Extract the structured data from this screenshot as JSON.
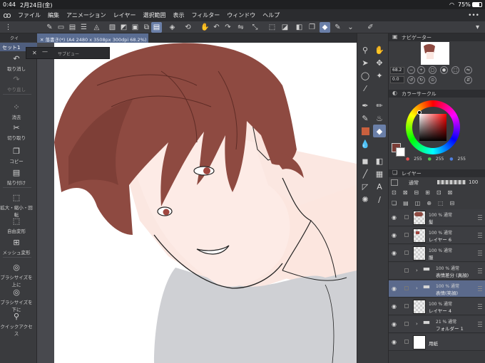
{
  "status": {
    "time": "0:44",
    "date": "2月24日(金)",
    "battery": "75%"
  },
  "menu": {
    "items": [
      "ファイル",
      "編集",
      "アニメーション",
      "レイヤー",
      "選択範囲",
      "表示",
      "フィルター",
      "ウィンドウ",
      "ヘルプ"
    ]
  },
  "tabs": {
    "left_panel_tab": "クイ",
    "document": "落書き(*) (A4 2480 x 3508px 300dpi 68.2%)"
  },
  "left_panel": {
    "set_label": "セット1",
    "commands": [
      {
        "label": "取り消し",
        "icon": "undo-icon",
        "glyph": "↶"
      },
      {
        "label": "やり直し",
        "icon": "redo-icon",
        "glyph": "↷",
        "disabled": true
      },
      {
        "label": "消去",
        "icon": "clear-icon",
        "glyph": "⁘"
      },
      {
        "label": "切り取り",
        "icon": "cut-icon",
        "glyph": "✂"
      },
      {
        "label": "コピー",
        "icon": "copy-icon",
        "glyph": "❐"
      },
      {
        "label": "貼り付け",
        "icon": "paste-icon",
        "glyph": "▤"
      },
      {
        "label": "拡大・縮小・回転",
        "icon": "scale-rotate-icon",
        "glyph": "⬚"
      },
      {
        "label": "自由変形",
        "icon": "free-transform-icon",
        "glyph": "⬚"
      },
      {
        "label": "メッシュ変形",
        "icon": "mesh-transform-icon",
        "glyph": "⊞"
      },
      {
        "label": "ブラシサイズを上に",
        "icon": "brush-size-up-icon",
        "glyph": "◎"
      },
      {
        "label": "ブラシサイズを下に",
        "icon": "brush-size-down-icon",
        "glyph": "◎"
      },
      {
        "label": "クイックアクセス",
        "icon": "quick-access-icon",
        "glyph": "⚲"
      }
    ]
  },
  "subview": {
    "label": "サブビュー"
  },
  "navigator": {
    "title": "ナビゲーター",
    "zoom": "68.2",
    "rotation": "0.0"
  },
  "color_circle": {
    "title": "カラーサークル",
    "r": "255",
    "g": "255",
    "b": "255",
    "main_color": "#7a3c36"
  },
  "layers": {
    "tab": "レイヤー",
    "blend_mode": "通常",
    "opacity": "100",
    "items": [
      {
        "meta": "100 % 通常",
        "name": "髪",
        "kind": "raster",
        "thumb": "hair"
      },
      {
        "meta": "100 % 通常",
        "name": "レイヤー 6",
        "kind": "raster",
        "thumb": "small-red"
      },
      {
        "meta": "100 % 通常",
        "name": "服",
        "kind": "raster",
        "thumb": "blank"
      },
      {
        "meta": "100 % 通常",
        "name": "表情差分 (真顔)",
        "kind": "folder",
        "hidden": true
      },
      {
        "meta": "100 % 通常",
        "name": "表情(笑顔)",
        "kind": "folder",
        "selected": true
      },
      {
        "meta": "100 % 通常",
        "name": "レイヤー 4",
        "kind": "raster",
        "thumb": "blank"
      },
      {
        "meta": "21 % 通常",
        "name": "フォルダー 1",
        "kind": "folder"
      },
      {
        "meta": "",
        "name": "用紙",
        "kind": "paper",
        "thumb": "white"
      }
    ]
  }
}
